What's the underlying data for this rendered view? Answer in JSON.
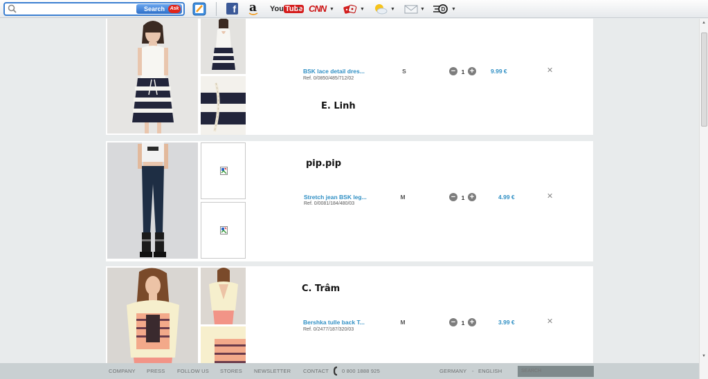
{
  "toolbar": {
    "search_placeholder": "",
    "search_button_label": "Search",
    "search_provider_badge": "Ask",
    "icons": [
      "search-icon",
      "notes-icon",
      "facebook-icon",
      "amazon-icon",
      "youtube-icon",
      "cnn-icon",
      "games-icon",
      "weather-icon",
      "mail-icon",
      "speed-icon"
    ],
    "amazon_label": "a",
    "youtube_label_1": "You",
    "youtube_label_2": "Tube",
    "cnn_label": "CNN",
    "facebook_label": "f"
  },
  "cart": {
    "items": [
      {
        "owner_note": "E. Linh",
        "name": "BSK lace detail dres...",
        "ref": "Ref. 0/0850/485/712/02",
        "size": "S",
        "quantity": "1",
        "price": "9.99 €"
      },
      {
        "owner_note": "pip.pip",
        "name": "Stretch jean BSK leg...",
        "ref": "Ref. 0/0081/184/480/03",
        "size": "M",
        "quantity": "1",
        "price": "4.99 €"
      },
      {
        "owner_note": "C. Trâm",
        "name": "Bershka tulle back T...",
        "ref": "Ref. 0/2477/187/320/03",
        "size": "M",
        "quantity": "1",
        "price": "3.99 €"
      }
    ],
    "remove_symbol": "✕",
    "minus_symbol": "−",
    "plus_symbol": "+"
  },
  "footer": {
    "links": [
      "COMPANY",
      "PRESS",
      "FOLLOW US",
      "STORES",
      "NEWSLETTER",
      "CONTACT"
    ],
    "phone": "0 800 1888 925",
    "country": "GERMANY",
    "separator": "-",
    "language": "ENGLISH",
    "search_placeholder": "SEARCH"
  },
  "colors": {
    "accent": "#2f8fc4",
    "footer_bg": "#c9d0d2",
    "page_bg": "#e8ebec"
  }
}
